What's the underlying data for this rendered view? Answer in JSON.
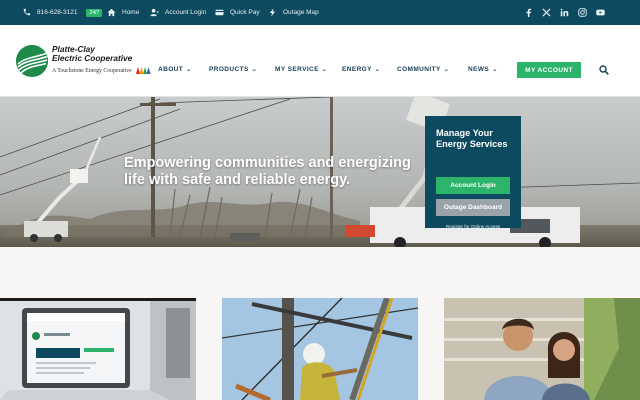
{
  "topbar": {
    "phone": "816-628-3121",
    "badge": "24/7",
    "links": [
      "Home",
      "Account Login",
      "Quick Pay",
      "Outage Map"
    ],
    "social": [
      "facebook-icon",
      "x-icon",
      "linkedin-icon",
      "instagram-icon",
      "youtube-icon"
    ]
  },
  "header": {
    "logo_line1": "Platte-Clay",
    "logo_line2": "Electric Cooperative",
    "logo_tagline": "A Touchstone Energy Cooperative",
    "nav": [
      "ABOUT",
      "PRODUCTS",
      "MY SERVICE",
      "ENERGY",
      "COMMUNITY",
      "NEWS"
    ],
    "cta": "MY ACCOUNT"
  },
  "hero": {
    "tagline": "Empowering communities and energizing life with safe and reliable energy."
  },
  "panel": {
    "title": "Manage Your Energy Services",
    "login_label": "Account Login",
    "outage_label": "Outage Dashboard",
    "register_link": "Register for Online Access"
  },
  "colors": {
    "brand_dark": "#0d4a5f",
    "accent_green": "#2db46b",
    "nav_text": "#173f58",
    "button_gray": "#9aa3a8"
  }
}
